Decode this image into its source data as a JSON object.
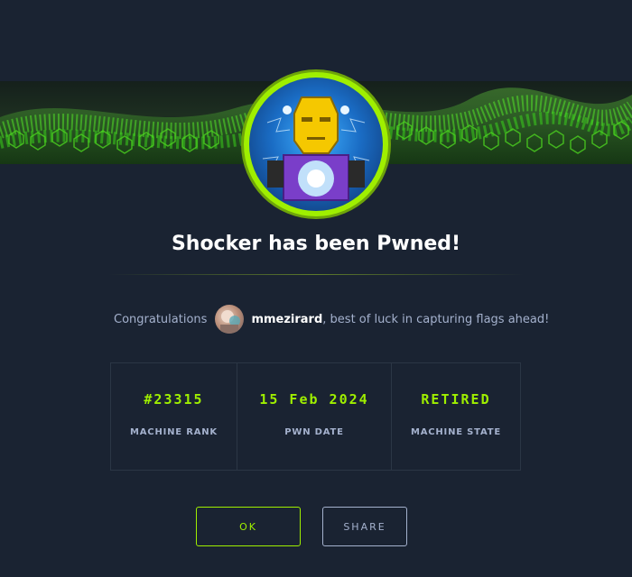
{
  "title": "Shocker has been Pwned!",
  "congrats": {
    "prefix": "Congratulations",
    "username": "mmezirard",
    "suffix": ", best of luck in capturing flags ahead!"
  },
  "stats": [
    {
      "value": "#23315",
      "label": "MACHINE RANK"
    },
    {
      "value": "15 Feb 2024",
      "label": "PWN DATE"
    },
    {
      "value": "RETIRED",
      "label": "MACHINE STATE"
    }
  ],
  "buttons": {
    "ok": "OK",
    "share": "SHARE"
  },
  "colors": {
    "accent": "#9fef00",
    "background": "#1a2332",
    "muted": "#a4b1cd"
  }
}
